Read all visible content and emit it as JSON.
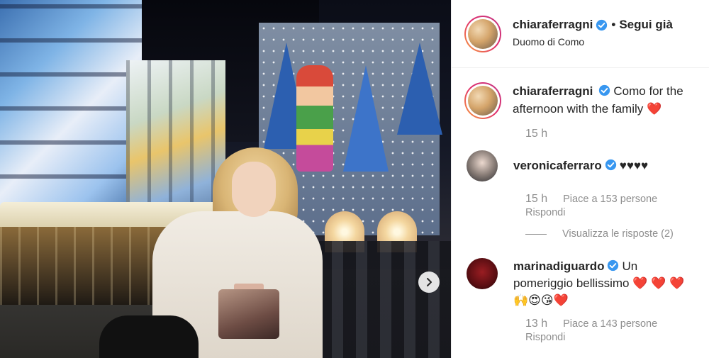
{
  "post": {
    "username": "chiaraferragni",
    "separator": "•",
    "follow_label": "Segui già",
    "location": "Duomo di Como"
  },
  "caption": {
    "username": "chiaraferragni",
    "text": "Como for the afternoon with the family",
    "emoji": "❤️",
    "time": "15 h"
  },
  "comments": [
    {
      "username": "veronicaferraro",
      "text": "♥♥♥♥",
      "time": "15 h",
      "likes": "Piace a 153 persone",
      "reply": "Rispondi",
      "view_replies": "Visualizza le risposte (2)"
    },
    {
      "username": "marinadiguardo",
      "text": "Un pomeriggio bellissimo",
      "emoji_line1": "❤️ ❤️ ❤️",
      "emoji_line2": "🙌😍😘❤️",
      "time": "13 h",
      "likes": "Piace a 143 persone",
      "reply": "Rispondi"
    }
  ],
  "icons": {
    "verified": "verified-badge-icon",
    "next": "chevron-right-icon"
  },
  "colors": {
    "verified_blue": "#3897f0",
    "muted_text": "#8e8e8e",
    "heart_red": "#e0245e"
  }
}
